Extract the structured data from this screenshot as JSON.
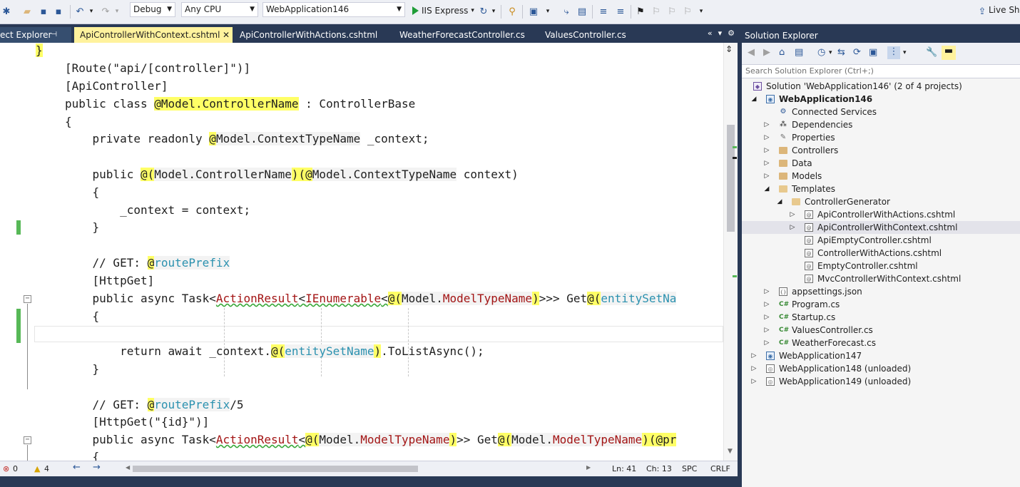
{
  "toolbar": {
    "config": "Debug",
    "platform": "Any CPU",
    "startup_project": "WebApplication146",
    "run_label": "IIS Express",
    "live_share": "Live Sh"
  },
  "tabs": {
    "pinned": "ect Explorer",
    "items": [
      "ApiControllerWithContext.cshtml",
      "ApiControllerWithActions.cshtml",
      "WeatherForecastController.cs",
      "ValuesController.cs"
    ]
  },
  "code": {
    "l0": "}",
    "l1": "[Route(\"api/[controller]\")]",
    "l2": "[ApiController]",
    "l3a": "public class ",
    "l3b": "@Model.ControllerName",
    "l3c": " : ControllerBase",
    "l4": "{",
    "l5a": "    private readonly ",
    "l5b": "@",
    "l5c": "Model.ContextTypeName",
    "l5d": " _context;",
    "l7a": "    public ",
    "l7b": "@(",
    "l7c": "Model.ControllerName",
    "l7d": ")(",
    "l7e": "@",
    "l7f": "Model.ContextTypeName",
    "l7g": " context)",
    "l8": "    {",
    "l9": "        _context = context;",
    "l10": "    }",
    "l12a": "    // GET: ",
    "l12b": "@",
    "l12c": "routePrefix",
    "l13": "    [HttpGet]",
    "l14a": "    public async Task<",
    "l14b": "ActionResult",
    "l14c": "<",
    "l14d": "IEnumerable",
    "l14e": "<",
    "l14f": "@(",
    "l14g": "Model.",
    "l14h": "ModelTypeName",
    "l14i": ")",
    "l14j": ">>> Get",
    "l14k": "@(",
    "l14l": "entitySetNa",
    "l15": "    {",
    "l17a": "        return await _context.",
    "l17b": "@(",
    "l17c": "entitySetName",
    "l17d": ")",
    "l17e": ".ToListAsync();",
    "l18": "    }",
    "l20a": "    // GET: ",
    "l20b": "@",
    "l20c": "routePrefix",
    "l20d": "/5",
    "l21": "    [HttpGet(\"{id}\")]",
    "l22a": "    public async Task<",
    "l22b": "ActionResult",
    "l22c": "<",
    "l22d": "@(",
    "l22e": "Model.",
    "l22f": "ModelTypeName",
    "l22g": ")",
    "l22h": ">> Get",
    "l22i": "@(",
    "l22j": "Model.",
    "l22k": "ModelTypeName",
    "l22l": ")",
    "l22m": "(",
    "l22n": "@pr",
    "l23": "    {"
  },
  "status": {
    "errors": "0",
    "warnings": "4",
    "line": "Ln: 41",
    "col": "Ch: 13",
    "spc": "SPC",
    "eol": "CRLF"
  },
  "solution_explorer": {
    "title": "Solution Explorer",
    "search_placeholder": "Search Solution Explorer (Ctrl+;)",
    "solution": "Solution 'WebApplication146' (2 of 4 projects)",
    "project": "WebApplication146",
    "items": {
      "connected": "Connected Services",
      "dependencies": "Dependencies",
      "properties": "Properties",
      "controllers": "Controllers",
      "data": "Data",
      "models": "Models",
      "templates": "Templates",
      "controller_generator": "ControllerGenerator",
      "f1": "ApiControllerWithActions.cshtml",
      "f2": "ApiControllerWithContext.cshtml",
      "f3": "ApiEmptyController.cshtml",
      "f4": "ControllerWithActions.cshtml",
      "f5": "EmptyController.cshtml",
      "f6": "MvcControllerWithContext.cshtml",
      "appsettings": "appsettings.json",
      "program": "Program.cs",
      "startup": "Startup.cs",
      "values": "ValuesController.cs",
      "weather": "WeatherForecast.cs",
      "p147": "WebApplication147",
      "p148": "WebApplication148 (unloaded)",
      "p149": "WebApplication149 (unloaded)"
    }
  },
  "colors": {
    "accent": "#293955",
    "active_tab": "#fff29d",
    "razor_highlight": "#ffff66",
    "change_bar": "#57b857"
  }
}
